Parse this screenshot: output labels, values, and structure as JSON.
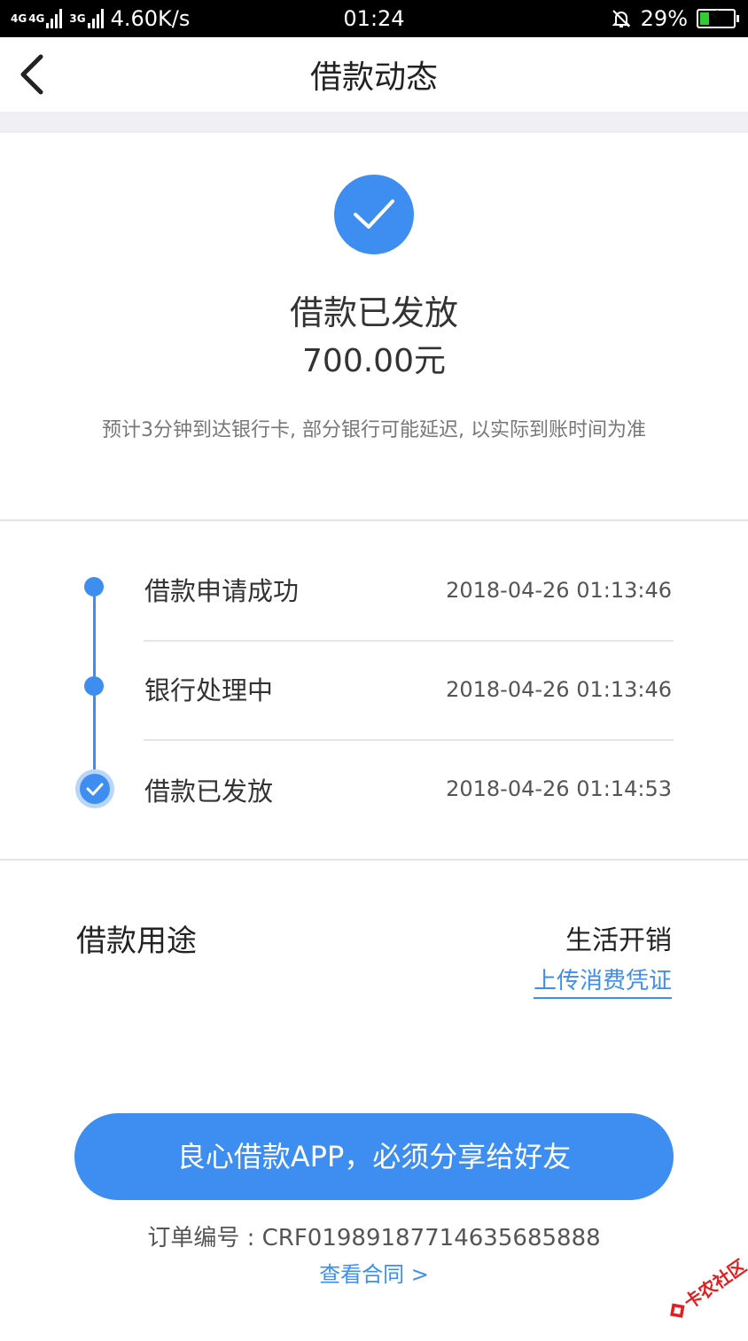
{
  "status_bar": {
    "network_1": "4G",
    "network_2": "4G",
    "network_3": "3G",
    "speed": "4.60K/s",
    "time": "01:24",
    "battery": "29%",
    "battery_level": 0.29,
    "battery_color": "#33cc33"
  },
  "nav": {
    "title": "借款动态"
  },
  "result": {
    "status": "借款已发放",
    "amount": "700.00元",
    "note": "预计3分钟到达银行卡, 部分银行可能延迟, 以实际到账时间为准"
  },
  "timeline": [
    {
      "label": "借款申请成功",
      "time": "2018-04-26 01:13:46"
    },
    {
      "label": "银行处理中",
      "time": "2018-04-26 01:13:46"
    },
    {
      "label": "借款已发放",
      "time": "2018-04-26 01:14:53"
    }
  ],
  "purpose": {
    "label": "借款用途",
    "value": "生活开销",
    "upload_link": "上传消费凭证"
  },
  "share_button": "良心借款APP，必须分享给好友",
  "order": {
    "number_text": "订单编号 : CRF01989187714635685888",
    "view_contract": "查看合同 >"
  },
  "watermark": {
    "text": "卡农社区"
  },
  "colors": {
    "accent": "#3d8ef0",
    "separator": "#efeff4"
  }
}
